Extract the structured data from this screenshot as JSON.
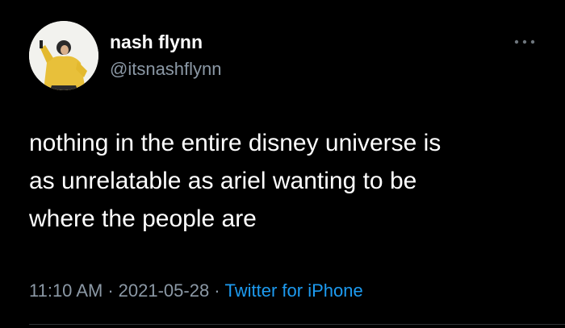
{
  "user": {
    "display_name": "nash flynn",
    "handle": "@itsnashflynn",
    "avatar_icon": "profile-photo"
  },
  "menu": {
    "icon": "more-horizontal-icon"
  },
  "tweet": {
    "lines": [
      "nothing in the entire disney universe is",
      "as unrelatable as ariel wanting to be",
      "where the people are"
    ]
  },
  "meta": {
    "time": "11:10 AM",
    "separator": "·",
    "date": "2021-05-28",
    "source": "Twitter for iPhone"
  },
  "colors": {
    "background": "#000000",
    "text_primary": "#ffffff",
    "text_secondary": "#8b98a5",
    "link": "#1d9bf0"
  }
}
